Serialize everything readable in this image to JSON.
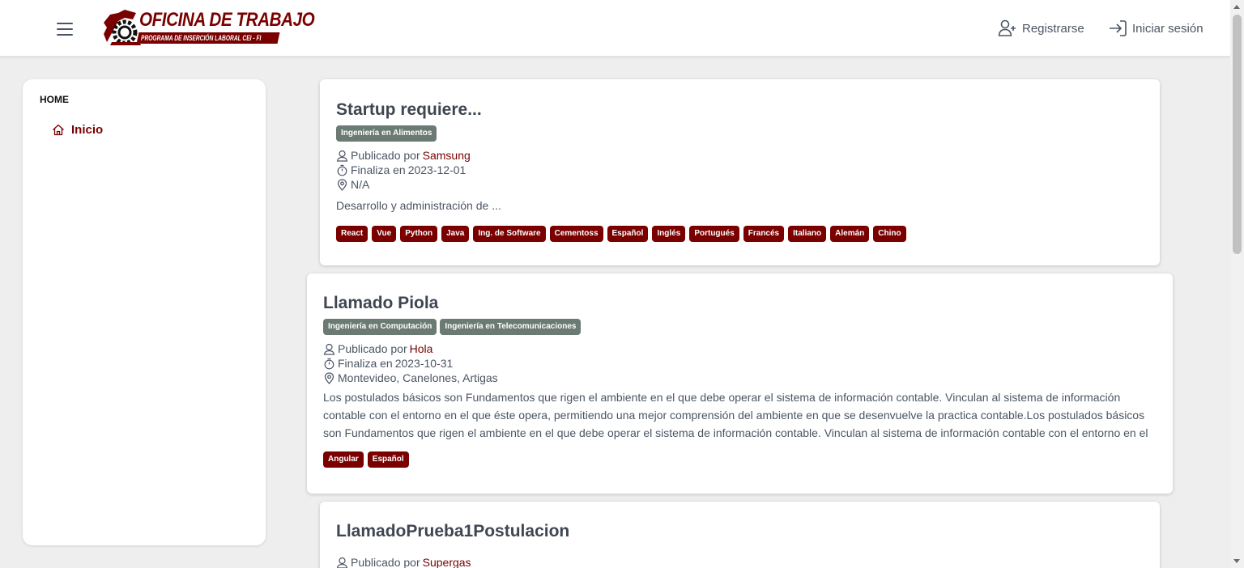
{
  "header": {
    "menu_icon": "hamburger-menu-icon",
    "logo": {
      "title": "OFICINA DE TRABAJO",
      "subtitle": "PROGRAMA DE INSERCIÓN LABORAL   CEI - FI"
    },
    "register_label": "Registrarse",
    "register_icon": "user-plus-icon",
    "login_label": "Iniciar sesión",
    "login_icon": "sign-in-icon"
  },
  "sidebar": {
    "heading": "HOME",
    "items": [
      {
        "label": "Inicio",
        "icon": "home-icon"
      }
    ]
  },
  "postings": [
    {
      "title": "Startup requiere...",
      "careers": [
        "Ingeniería en Alimentos"
      ],
      "published_by_label": "Publicado por",
      "company": "Samsung",
      "ends_label": "Finaliza en",
      "end_date": "2023-12-01",
      "location": "N/A",
      "description": "Desarrollo y administración de ...",
      "skills": [
        "React",
        "Vue",
        "Python",
        "Java",
        "Ing. de Software",
        "Cementoss",
        "Español",
        "Inglés",
        "Portugués",
        "Francés",
        "Italiano",
        "Alemán",
        "Chino"
      ]
    },
    {
      "title": "Llamado Piola",
      "careers": [
        "Ingeniería en Computación",
        "Ingeniería en Telecomunicaciones"
      ],
      "published_by_label": "Publicado por",
      "company": "Hola",
      "ends_label": "Finaliza en",
      "end_date": "2023-10-31",
      "location": "Montevideo, Canelones, Artigas",
      "description": "Los postulados básicos son Fundamentos que rigen el ambiente en el que debe operar el sistema de información contable. Vinculan al sistema de información contable con el entorno en el que éste opera, permitiendo una mejor comprensión del ambiente en que se desenvuelve la practica contable.Los postulados básicos son Fundamentos que rigen el ambiente en el que debe operar el sistema de información contable. Vinculan al sistema de información contable con el entorno en el",
      "skills": [
        "Angular",
        "Español"
      ]
    },
    {
      "title": "LlamadoPrueba1Postulacion",
      "published_by_label": "Publicado por",
      "company": "Supergas"
    }
  ],
  "colors": {
    "brand": "#7a0000",
    "career_tag": "#6b7a72",
    "page_bg": "#eeeeee"
  }
}
